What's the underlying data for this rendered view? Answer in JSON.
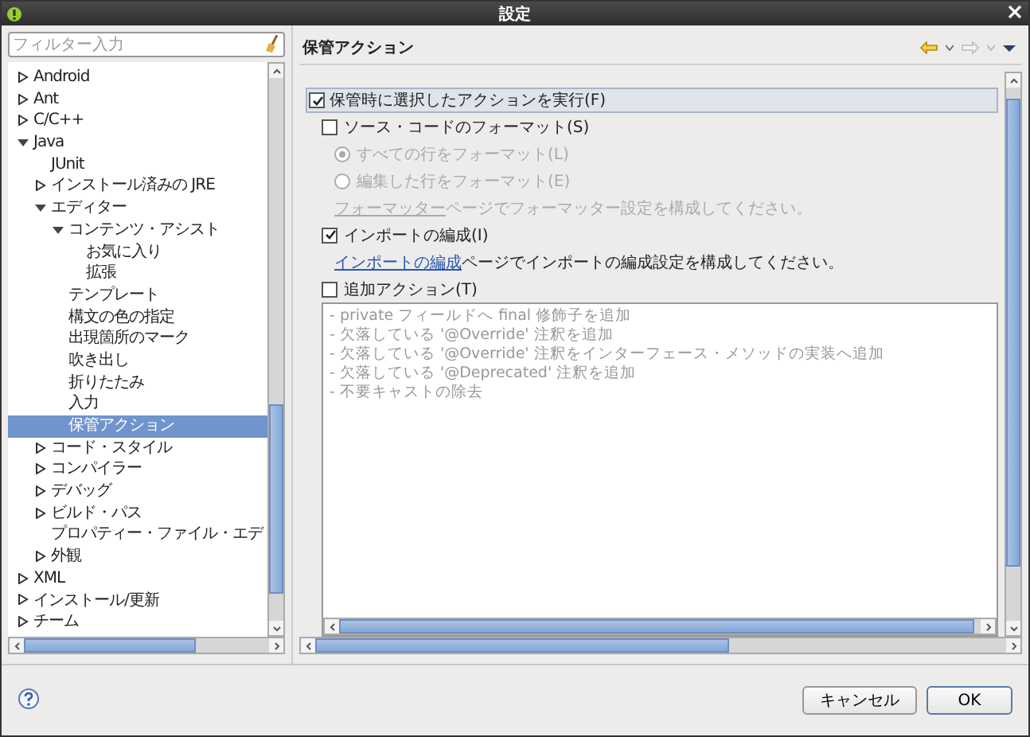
{
  "window": {
    "title": "設定"
  },
  "sidebar": {
    "filter": {
      "placeholder": "フィルター入力"
    },
    "tree": [
      {
        "label": "Android",
        "kind": "folder",
        "expanded": false,
        "selected": false
      },
      {
        "label": "Ant",
        "kind": "folder",
        "expanded": false,
        "selected": false
      },
      {
        "label": "C/C++",
        "kind": "folder",
        "expanded": false,
        "selected": false
      },
      {
        "label": "Java",
        "kind": "folder",
        "expanded": true,
        "selected": false,
        "children": [
          {
            "label": "JUnit",
            "kind": "leaf",
            "expanded": false,
            "selected": false
          },
          {
            "label": "インストール済みの JRE",
            "kind": "folder",
            "expanded": false,
            "selected": false
          },
          {
            "label": "エディター",
            "kind": "folder",
            "expanded": true,
            "selected": false,
            "children": [
              {
                "label": "コンテンツ・アシスト",
                "kind": "folder",
                "expanded": true,
                "selected": false,
                "children": [
                  {
                    "label": "お気に入り",
                    "kind": "leaf",
                    "expanded": false,
                    "selected": false
                  },
                  {
                    "label": "拡張",
                    "kind": "leaf",
                    "expanded": false,
                    "selected": false
                  }
                ]
              },
              {
                "label": "テンプレート",
                "kind": "leaf",
                "expanded": false,
                "selected": false
              },
              {
                "label": "構文の色の指定",
                "kind": "leaf",
                "expanded": false,
                "selected": false
              },
              {
                "label": "出現箇所のマーク",
                "kind": "leaf",
                "expanded": false,
                "selected": false
              },
              {
                "label": "吹き出し",
                "kind": "leaf",
                "expanded": false,
                "selected": false
              },
              {
                "label": "折りたたみ",
                "kind": "leaf",
                "expanded": false,
                "selected": false
              },
              {
                "label": "入力",
                "kind": "leaf",
                "expanded": false,
                "selected": false
              },
              {
                "label": "保管アクション",
                "kind": "leaf",
                "expanded": false,
                "selected": true
              }
            ]
          },
          {
            "label": "コード・スタイル",
            "kind": "folder",
            "expanded": false,
            "selected": false
          },
          {
            "label": "コンパイラー",
            "kind": "folder",
            "expanded": false,
            "selected": false
          },
          {
            "label": "デバッグ",
            "kind": "folder",
            "expanded": false,
            "selected": false
          },
          {
            "label": "ビルド・パス",
            "kind": "folder",
            "expanded": false,
            "selected": false
          },
          {
            "label": "プロパティー・ファイル・エデ",
            "kind": "leaf",
            "expanded": false,
            "selected": false
          },
          {
            "label": "外観",
            "kind": "folder",
            "expanded": false,
            "selected": false
          }
        ]
      },
      {
        "label": "XML",
        "kind": "folder",
        "expanded": false,
        "selected": false
      },
      {
        "label": "インストール/更新",
        "kind": "folder",
        "expanded": false,
        "selected": false
      },
      {
        "label": "チーム",
        "kind": "folder",
        "expanded": false,
        "selected": false
      }
    ]
  },
  "page": {
    "title": "保管アクション",
    "main_action": {
      "label": "保管時に選択したアクションを実行(F)",
      "checked": true
    },
    "options": [
      {
        "kind": "checkbox",
        "label": "ソース・コードのフォーマット(S)",
        "checked": false,
        "disabled": false
      },
      {
        "kind": "radio",
        "label": "すべての行をフォーマット(L)",
        "selected": true,
        "disabled": true
      },
      {
        "kind": "radio",
        "label": "編集した行をフォーマット(E)",
        "selected": false,
        "disabled": true
      },
      {
        "kind": "note",
        "link": "フォーマッター",
        "text": "ページでフォーマッター設定を構成してください。",
        "disabled": true
      },
      {
        "kind": "checkbox",
        "label": "インポートの編成(I)",
        "checked": true,
        "disabled": false
      },
      {
        "kind": "note",
        "link": "インポートの編成",
        "text": "ページでインポートの編成設定を構成してください。",
        "disabled": false
      },
      {
        "kind": "checkbox",
        "label": "追加アクション(T)",
        "checked": false,
        "disabled": false
      }
    ],
    "additional_actions": [
      "- private フィールドへ final 修飾子を追加",
      "- 欠落している '@Override' 注釈を追加",
      "- 欠落している '@Override' 注釈をインターフェース・メソッドの実装へ追加",
      "- 欠落している '@Deprecated' 注釈を追加",
      "- 不要キャストの除去"
    ]
  },
  "buttons": [
    {
      "label": "キャンセル",
      "default": false
    },
    {
      "label": "OK",
      "default": true
    }
  ]
}
